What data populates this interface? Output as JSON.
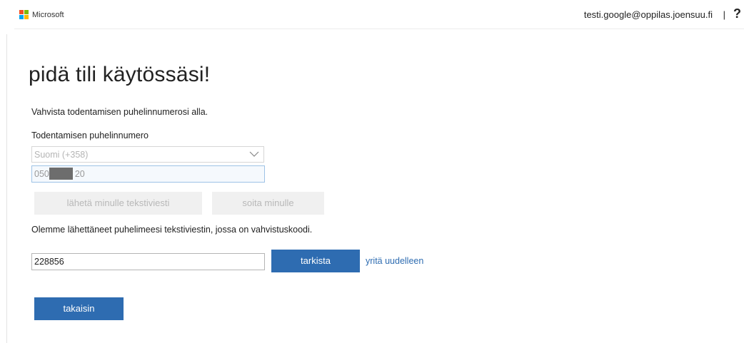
{
  "header": {
    "brand": "Microsoft",
    "user_email": "testi.google@oppilas.joensuu.fi",
    "divider": "|",
    "help": "?"
  },
  "colors": {
    "logo_red": "#f25022",
    "logo_green": "#7fba00",
    "logo_blue": "#00a4ef",
    "logo_yellow": "#ffb900",
    "primary": "#2e6cb1"
  },
  "main": {
    "title": "pidä tili käytössäsi!",
    "instruction": "Vahvista todentamisen puhelinnumerosi alla.",
    "phone_label": "Todentamisen puhelinnumero",
    "country_select_value": "Suomi (+358)",
    "phone_value_start": "050",
    "phone_value_end": "20",
    "send_sms_label": "lähetä minulle tekstiviesti",
    "call_me_label": "soita minulle",
    "sent_message": "Olemme lähettäneet puhelimeesi tekstiviestin, jossa on vahvistuskoodi.",
    "code_value": "228856",
    "verify_label": "tarkista",
    "retry_label": "yritä uudelleen",
    "back_label": "takaisin"
  }
}
